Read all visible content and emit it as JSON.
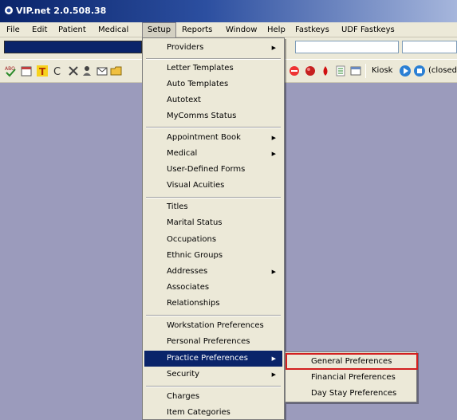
{
  "window": {
    "title": "VIP.net 2.0.508.38"
  },
  "menubar": {
    "items": [
      "File",
      "Edit",
      "Patient",
      "Medical",
      "Setup",
      "Reports",
      "Window",
      "Help",
      "Fastkeys",
      "UDF Fastkeys"
    ],
    "active": "Setup"
  },
  "toolbar": {
    "icons": [
      "abo-check-icon",
      "calendar-icon",
      "text-t-icon",
      "letter-c-icon",
      "cross-icon",
      "user-key-icon",
      "envelope-icon",
      "folder-icon",
      "no-entry-icon",
      "red-circle-icon",
      "blood-drop-icon",
      "list-icon",
      "window-icon"
    ],
    "kiosk_label": "Kiosk",
    "status_label": "(closed"
  },
  "setup_menu": {
    "items": [
      {
        "label": "Providers",
        "submenu": true
      },
      {
        "separator": true
      },
      {
        "label": "Letter Templates"
      },
      {
        "label": "Auto Templates"
      },
      {
        "label": "Autotext"
      },
      {
        "label": "MyComms Status"
      },
      {
        "separator": true
      },
      {
        "label": "Appointment Book",
        "submenu": true
      },
      {
        "label": "Medical",
        "submenu": true
      },
      {
        "label": "User-Defined Forms"
      },
      {
        "label": "Visual Acuities"
      },
      {
        "separator": true
      },
      {
        "label": "Titles"
      },
      {
        "label": "Marital Status"
      },
      {
        "label": "Occupations"
      },
      {
        "label": "Ethnic Groups"
      },
      {
        "label": "Addresses",
        "submenu": true
      },
      {
        "label": "Associates"
      },
      {
        "label": "Relationships"
      },
      {
        "separator": true
      },
      {
        "label": "Workstation Preferences"
      },
      {
        "label": "Personal Preferences"
      },
      {
        "label": "Practice Preferences",
        "submenu": true,
        "highlighted": true
      },
      {
        "label": "Security",
        "submenu": true
      },
      {
        "separator": true
      },
      {
        "label": "Charges"
      },
      {
        "label": "Item Categories"
      }
    ]
  },
  "practice_preferences_submenu": {
    "items": [
      "General Preferences",
      "Financial Preferences",
      "Day Stay Preferences"
    ],
    "outlined": "General Preferences",
    "outline_color": "#d21f1f"
  },
  "colors": {
    "workspace": "#9b9bbc",
    "highlight": "#0a246a",
    "menu_bg": "#ece9d8"
  }
}
